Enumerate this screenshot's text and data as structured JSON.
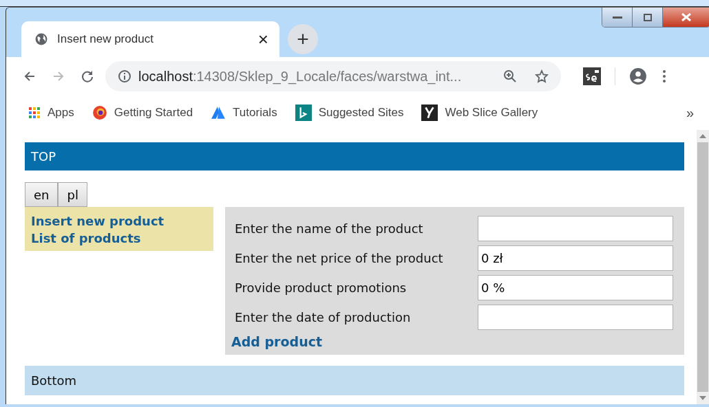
{
  "tab": {
    "title": "Insert new product",
    "close": "×",
    "new_tab": "+"
  },
  "address_bar": {
    "host": "localhost",
    "path": ":14308/Sklep_9_Locale/faces/warstwa_int..."
  },
  "bookmarks": [
    {
      "label": "Apps",
      "kind": "apps"
    },
    {
      "label": "Getting Started",
      "kind": "firefox"
    },
    {
      "label": "Tutorials",
      "kind": "tutorials"
    },
    {
      "label": "Suggested Sites",
      "kind": "bing"
    },
    {
      "label": "Web Slice Gallery",
      "kind": "slice"
    }
  ],
  "bookmarks_more": "»",
  "page": {
    "header": "TOP",
    "languages": [
      {
        "label": "en"
      },
      {
        "label": "pl"
      }
    ],
    "menu": [
      {
        "label": "Insert new product"
      },
      {
        "label": "List of products"
      }
    ],
    "form": {
      "fields": [
        {
          "label": "Enter the name of the product"
        },
        {
          "label": "Enter the net price of the product",
          "value": "0 zł"
        },
        {
          "label": "Provide product promotions",
          "value": "0 %"
        },
        {
          "label": "Enter the date of production"
        }
      ],
      "submit": "Add product"
    },
    "footer": "Bottom"
  }
}
